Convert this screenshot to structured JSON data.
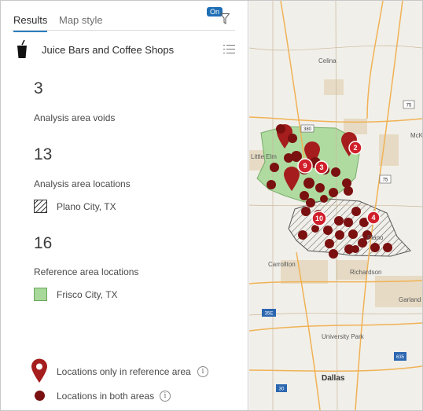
{
  "tabs": {
    "results": "Results",
    "map_style": "Map style"
  },
  "filter_badge": "On",
  "layer": {
    "title": "Juice Bars and Coffee Shops",
    "icon": "drink-cup-icon"
  },
  "stats": [
    {
      "value": "3",
      "label": "Analysis area voids"
    },
    {
      "value": "13",
      "label": "Analysis area locations"
    },
    {
      "value": "16",
      "label": "Reference area locations"
    }
  ],
  "areas": {
    "analysis": {
      "name": "Plano City, TX",
      "style": "hatched"
    },
    "reference": {
      "name": "Frisco City, TX",
      "color": "#a8d99a"
    }
  },
  "legend": {
    "reference_only": "Locations only in reference area",
    "both": "Locations in both areas",
    "marker_color": "#7a1010"
  },
  "map": {
    "places": {
      "celina": "Celina",
      "little_elm": "Little Elm",
      "plano": "Plano",
      "carrollton": "Carrollton",
      "richardson": "Richardson",
      "garland": "Garland",
      "university_park": "University Park",
      "dallas": "Dallas",
      "mck": "McK"
    },
    "highway_shields": [
      "75",
      "75",
      "380",
      "35E",
      "635",
      "30"
    ],
    "cluster_counts": [
      "2",
      "9",
      "3",
      "10",
      "4"
    ]
  }
}
